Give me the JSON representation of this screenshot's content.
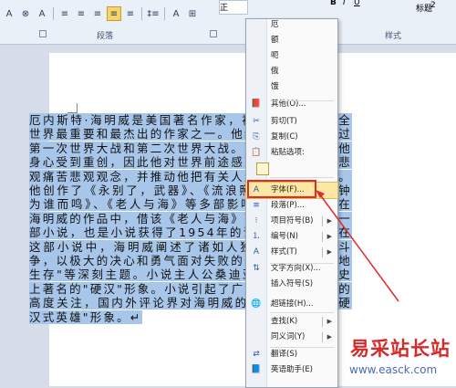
{
  "ribbon": {
    "buttons_row": [
      "A",
      "⊗",
      "A",
      "≡",
      "≡",
      "≡",
      "≡",
      "≡",
      "‡≡",
      "A",
      "⊞"
    ],
    "paragraph_group_label": "段落",
    "styles_group_label": "样式",
    "style_normal_label": "正",
    "style_heading2_label": "2",
    "style_title_label": "标题",
    "toolbar_row_b": "B",
    "toolbar_row_i": "I",
    "toolbar_row_u": "U"
  },
  "document": {
    "text": "厄内斯特·海明威是美国著名作家，被认为二十世纪全世界最重要和最杰出的作家之一。他经历曲折，参加过第一次世界大战和第二次世界大战。两次世界大战使他身心受到重创，因此他对世界前途感到失望，产生了悲观痛苦悲观观念，并推动他把有关人生命运等于笔端。他创作了《永别了，武器》、《流浪照常升起》、《丧钟为谁而鸣》、《老人与海》等多部影响深远的作品。在海明威的作品中，借该《老人与海》可谓是最著名的一部小说，也是小说获得了1954年的诺贝尔文学奖。在这部小说中，海明威阐述了诸如人独自与大自然的斗争，以极大的决心和勇气面对失败的悲剧，作为优雅地生存\"等深刻主题。小说主人公桑迪亚哥也成为文学史上著名的\"硬汉\"形象。小说引起了广大读者和评论界的高度关注，国内外评论界对海明威的研究最多的是\"硬汉式英雄\"形象。↵"
  },
  "menu": {
    "items": [
      {
        "label": "厄",
        "icon": "",
        "shortcut": "",
        "submenu": false
      },
      {
        "label": "额",
        "icon": "",
        "shortcut": "",
        "submenu": false
      },
      {
        "label": "呃",
        "icon": "",
        "shortcut": "",
        "submenu": false
      },
      {
        "label": "俄",
        "icon": "",
        "shortcut": "",
        "submenu": false
      },
      {
        "label": "饿",
        "icon": "",
        "shortcut": "",
        "submenu": false
      },
      {
        "label": "其他(O)...",
        "icon": "📕",
        "shortcut": "",
        "submenu": false
      },
      {
        "label": "剪切(T)",
        "icon": "✂",
        "shortcut": "",
        "submenu": false
      },
      {
        "label": "复制(C)",
        "icon": "⎘",
        "shortcut": "",
        "submenu": false
      },
      {
        "label": "粘贴选项:",
        "icon": "📋",
        "shortcut": "",
        "submenu": false
      },
      {
        "label": "字体(F)...",
        "icon": "A",
        "shortcut": "",
        "submenu": false
      },
      {
        "label": "段落(P)...",
        "icon": "≡",
        "shortcut": "",
        "submenu": false
      },
      {
        "label": "项目符号(B)",
        "icon": "⁝",
        "shortcut": "",
        "submenu": true
      },
      {
        "label": "编号(N)",
        "icon": "⒈",
        "shortcut": "",
        "submenu": true
      },
      {
        "label": "样式(T)",
        "icon": "A",
        "shortcut": "",
        "submenu": true
      },
      {
        "label": "文字方向(X)...",
        "icon": "⇅",
        "shortcut": "",
        "submenu": false
      },
      {
        "label": "插入符号(S)",
        "icon": "",
        "shortcut": "",
        "submenu": false
      },
      {
        "label": "超链接(H)...",
        "icon": "🌐",
        "shortcut": "",
        "submenu": false
      },
      {
        "label": "查找(K)",
        "icon": "",
        "shortcut": "",
        "submenu": true
      },
      {
        "label": "同义词(Y)",
        "icon": "",
        "shortcut": "",
        "submenu": true
      },
      {
        "label": "翻译(S)",
        "icon": "⇄",
        "shortcut": "",
        "submenu": false
      },
      {
        "label": "英语助手(E)",
        "icon": "📘",
        "shortcut": "",
        "submenu": false
      }
    ]
  },
  "watermark": {
    "brand": "易采站长站",
    "url": "www.easck.com"
  },
  "colors": {
    "highlight": "#fde7a6",
    "selection": "#a8c6ea",
    "annotation": "#e02b2b",
    "brand": "#d72a2a"
  }
}
